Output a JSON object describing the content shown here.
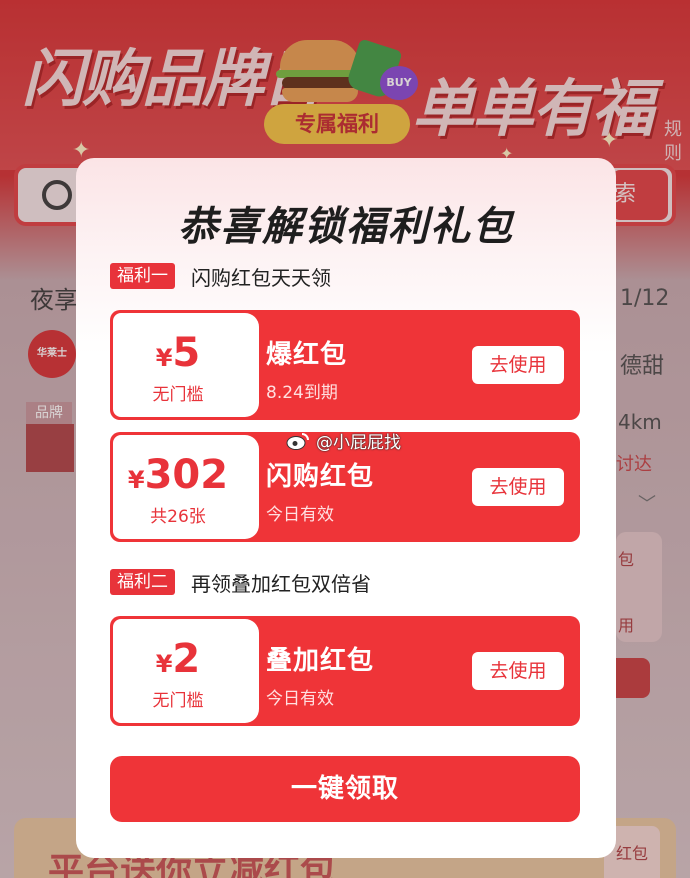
{
  "background": {
    "title_left": "闪购品牌日",
    "title_right": "单单有福利",
    "exclusive_badge": "专属福利",
    "buy_badge": "BUY",
    "rules": "规则",
    "search_button": "索",
    "left_label": "夜享",
    "page_counter": "1/12",
    "left_logo_text": "华莱士",
    "brand_tag": "品牌",
    "right_text_1": "德甜",
    "right_text_2": "4km",
    "right_text_3": "讨达",
    "right_card_1": "包",
    "right_card_2": "用",
    "bottom_banner_text": "平台送你立减红包",
    "bottom_right_card": "红包"
  },
  "modal": {
    "title": "恭喜解锁福利礼包",
    "section1": {
      "tag": "福利一",
      "text": "闪购红包天天领"
    },
    "section2": {
      "tag": "福利二",
      "text": "再领叠加红包双倍省"
    },
    "coupons": [
      {
        "currency": "¥",
        "amount": "5",
        "condition": "无门槛",
        "name": "爆红包",
        "subtitle": "8.24到期",
        "button": "去使用"
      },
      {
        "currency": "¥",
        "amount": "302",
        "condition": "共26张",
        "name": "闪购红包",
        "subtitle": "今日有效",
        "button": "去使用"
      },
      {
        "currency": "¥",
        "amount": "2",
        "condition": "无门槛",
        "name": "叠加红包",
        "subtitle": "今日有效",
        "button": "去使用"
      }
    ],
    "claim_button": "一键领取"
  },
  "watermark": "@小屁屁找",
  "colors": {
    "accent_red": "#ef3438",
    "tag_red": "#e8333a",
    "white": "#ffffff"
  }
}
